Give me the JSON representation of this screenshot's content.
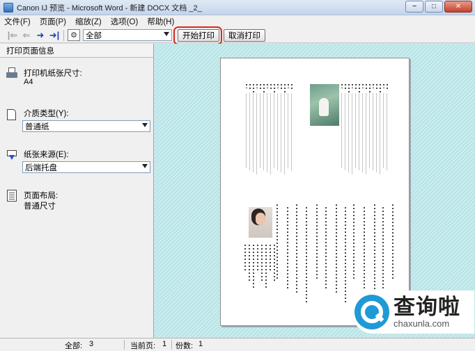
{
  "window": {
    "title": "Canon IJ 预览 - Microsoft Word - 新建 DOCX 文档 _2_",
    "controls": [
      "−",
      "□",
      "✕"
    ]
  },
  "menu": {
    "items": [
      "文件(F)",
      "页面(P)",
      "缩放(Z)",
      "选项(O)",
      "帮助(H)"
    ]
  },
  "toolbar": {
    "nav_first": "|⇐",
    "nav_prev": "⇐",
    "nav_next": "➜",
    "nav_last": "➜|",
    "page_range_value": "全部",
    "start_print_label": "开始打印",
    "cancel_print_label": "取消打印"
  },
  "panel": {
    "title": "打印页面信息",
    "paper_size_label": "打印机纸张尺寸:",
    "paper_size_value": "A4",
    "media_type_label": "介质类型(Y):",
    "media_type_value": "普通纸",
    "paper_source_label": "纸张来源(E):",
    "paper_source_value": "后端托盘",
    "page_layout_label": "页面布局:",
    "page_layout_value": "普通尺寸"
  },
  "status": {
    "total_label": "全部:",
    "total_value": "3",
    "current_label": "当前页:",
    "current_value": "1",
    "copies_label": "份数:",
    "copies_value": "1"
  },
  "watermark": {
    "cn": "查询啦",
    "en": "chaxunla.com"
  },
  "colors": {
    "highlight": "#d9271e",
    "preview_bg": "#c9ecee",
    "logo_blue": "#1f9ad6"
  },
  "icons": [
    "app-icon",
    "first-page-icon",
    "prev-page-icon",
    "next-page-icon",
    "last-page-icon",
    "settings-icon",
    "printer-icon",
    "media-icon",
    "paper-source-icon",
    "page-layout-icon",
    "dropdown-arrow-icon",
    "search-logo-icon"
  ]
}
